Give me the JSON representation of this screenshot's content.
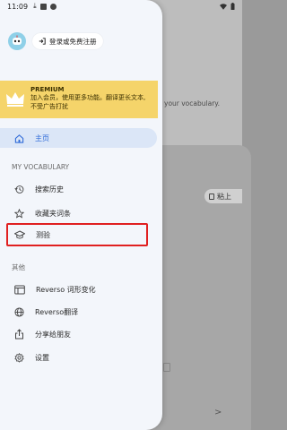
{
  "status_bar": {
    "time": "11:09"
  },
  "background": {
    "text": "your vocabulary.",
    "paste_label": "粘上"
  },
  "drawer": {
    "login_label": "登录或免费注册",
    "premium": {
      "title": "PREMIUM",
      "line1": "加入会员，使用更多功能。翻译更长文本,",
      "line2": "不受广告打扰"
    },
    "home_label": "主页",
    "section_vocab": "MY VOCABULARY",
    "vocab_items": [
      {
        "label": "搜索历史",
        "icon": "history-icon"
      },
      {
        "label": "收藏夹词条",
        "icon": "star-icon"
      },
      {
        "label": "测验",
        "icon": "graduation-cap-icon"
      }
    ],
    "section_other": "其他",
    "other_items": [
      {
        "label": "Reverso 词形变化",
        "icon": "conjugation-icon"
      },
      {
        "label": "Reverso翻译",
        "icon": "globe-icon"
      },
      {
        "label": "分享给朋友",
        "icon": "share-icon"
      },
      {
        "label": "设置",
        "icon": "settings-icon"
      }
    ]
  },
  "colors": {
    "accent": "#2f6bd8",
    "premium_bg": "#f5d46a",
    "highlight": "#e02020",
    "home_bg": "#dbe6f7"
  }
}
